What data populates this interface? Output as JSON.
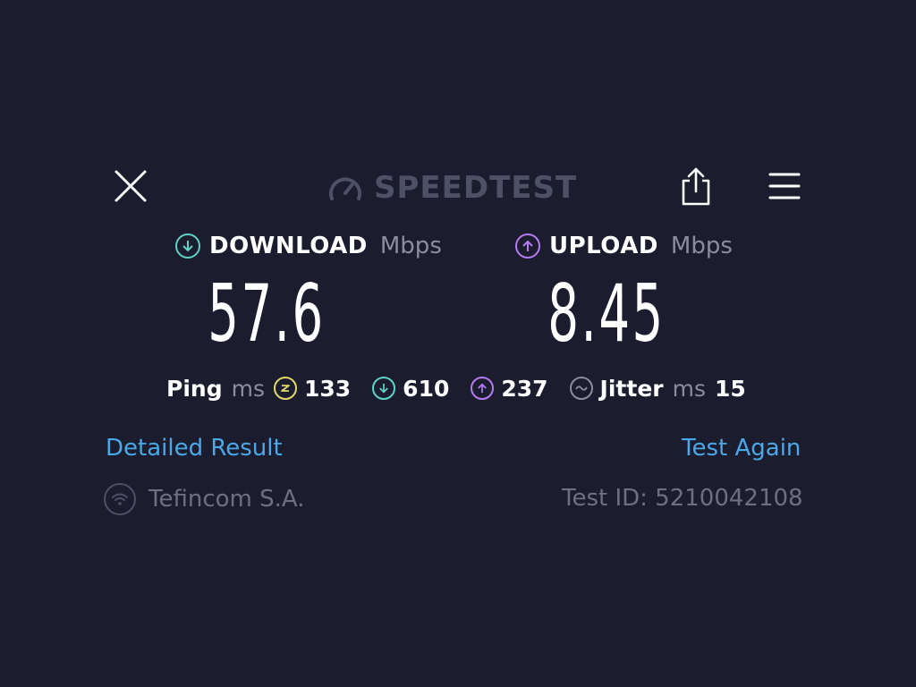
{
  "app": {
    "logo_text": "SPEEDTEST",
    "logo_icon": "gauge-icon"
  },
  "toolbar": {
    "close_icon": "close-icon",
    "share_icon": "share-icon",
    "menu_icon": "hamburger-menu-icon"
  },
  "download": {
    "label": "DOWNLOAD",
    "unit": "Mbps",
    "value": "57.6",
    "icon": "download-arrow-icon",
    "color": "#5fd3c6"
  },
  "upload": {
    "label": "UPLOAD",
    "unit": "Mbps",
    "value": "8.45",
    "icon": "upload-arrow-icon",
    "color": "#b57cf2"
  },
  "stats": {
    "ping_label": "Ping",
    "ping_unit": "ms",
    "idle_ping": "133",
    "idle_icon": "idle-ping-icon",
    "idle_color": "#e2d86a",
    "download_ping": "610",
    "upload_ping": "237",
    "jitter_label": "Jitter",
    "jitter_unit": "ms",
    "jitter_value": "15",
    "jitter_icon": "jitter-wave-icon"
  },
  "links": {
    "detailed_result": "Detailed Result",
    "test_again": "Test Again"
  },
  "footer": {
    "provider": "Tefincom S.A.",
    "provider_icon": "wifi-icon",
    "test_id": "Test ID: 5210042108"
  }
}
